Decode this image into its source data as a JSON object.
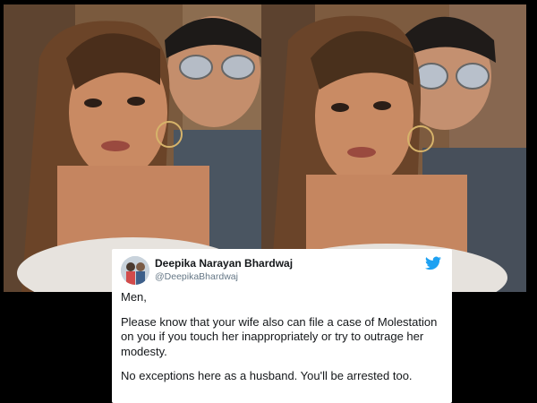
{
  "images": {
    "left_photo": "selfie-couple-photo",
    "right_photo": "selfie-couple-photo"
  },
  "tweet": {
    "author_name": "Deepika Narayan Bhardwaj",
    "author_handle": "@DeepikaBhardwaj",
    "icon": "twitter-bird-icon",
    "brand_color": "#1da1f2",
    "paragraphs": [
      "Men,",
      "Please know that your wife also can file a case of Molestation on you if you touch her inappropriately or try to outrage her modesty.",
      "No exceptions here as a husband. You'll be arrested too."
    ]
  }
}
